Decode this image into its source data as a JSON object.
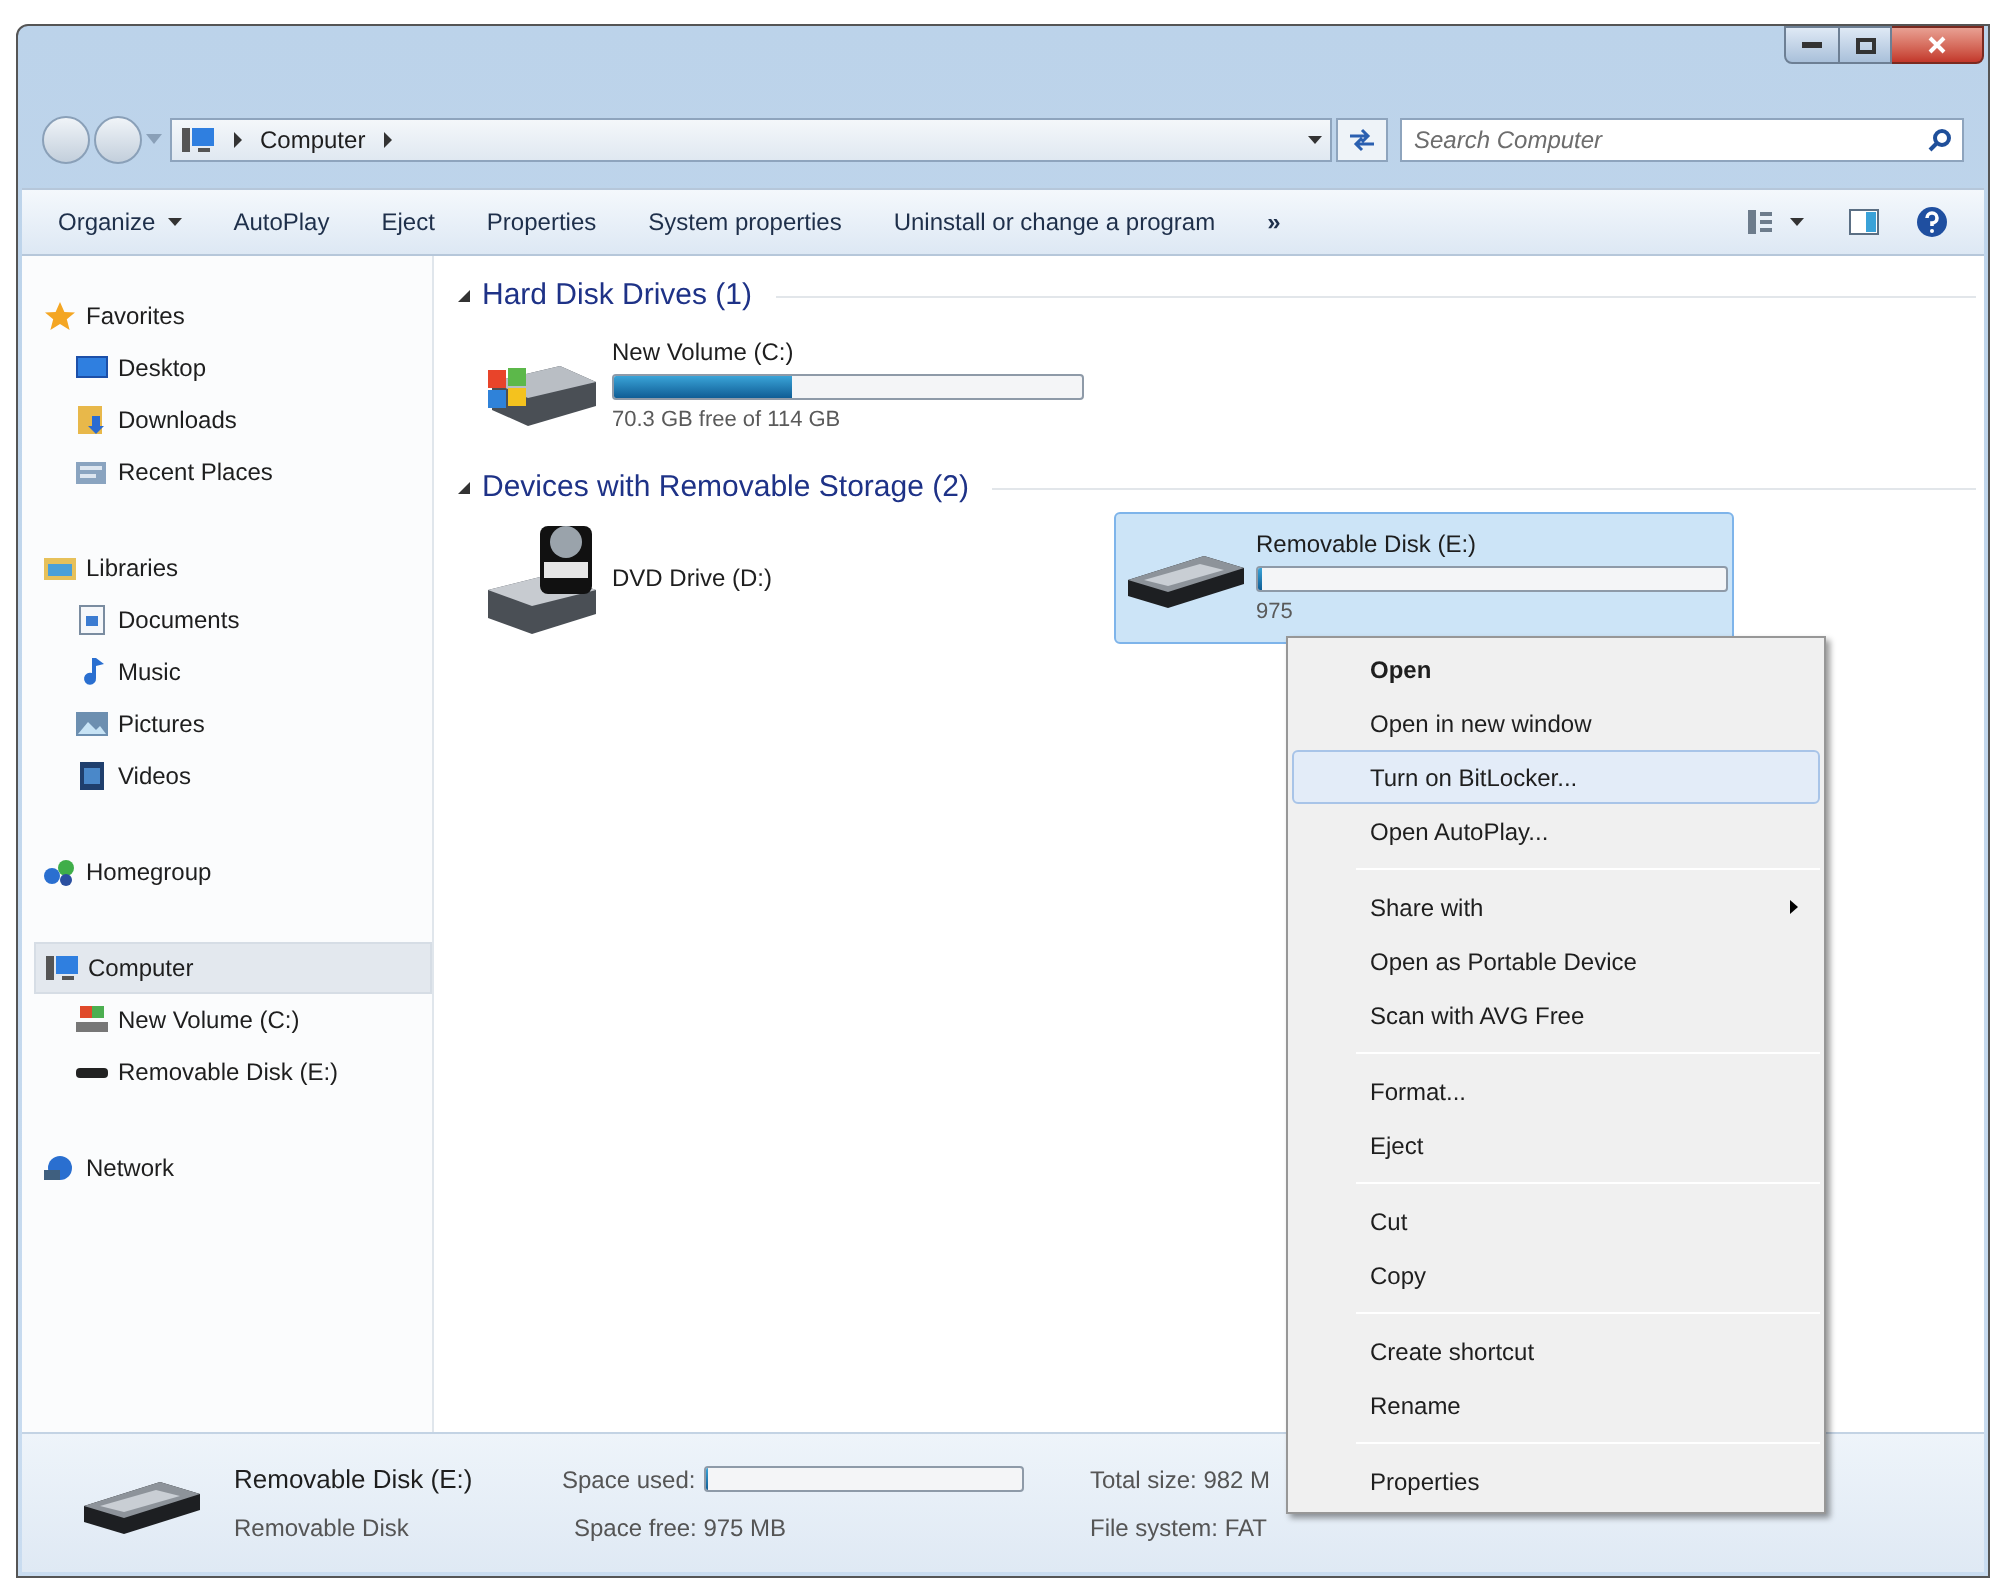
{
  "address_bar": {
    "crumbs": [
      "Computer"
    ]
  },
  "search": {
    "placeholder": "Search Computer"
  },
  "toolbar": {
    "items": [
      {
        "label": "Organize",
        "has_menu": true
      },
      {
        "label": "AutoPlay",
        "has_menu": false
      },
      {
        "label": "Eject",
        "has_menu": false
      },
      {
        "label": "Properties",
        "has_menu": false
      },
      {
        "label": "System properties",
        "has_menu": false
      },
      {
        "label": "Uninstall or change a program",
        "has_menu": false
      }
    ],
    "overflow": "»"
  },
  "sidebar": {
    "groups": [
      {
        "label": "Favorites",
        "selected": false,
        "children": [
          {
            "label": "Desktop",
            "selected": false
          },
          {
            "label": "Downloads",
            "selected": false
          },
          {
            "label": "Recent Places",
            "selected": false
          }
        ]
      },
      {
        "label": "Libraries",
        "selected": false,
        "children": [
          {
            "label": "Documents",
            "selected": false
          },
          {
            "label": "Music",
            "selected": false
          },
          {
            "label": "Pictures",
            "selected": false
          },
          {
            "label": "Videos",
            "selected": false
          }
        ]
      },
      {
        "label": "Homegroup",
        "selected": false
      },
      {
        "label": "Computer",
        "selected": true,
        "children": [
          {
            "label": "New Volume (C:)",
            "selected": false
          },
          {
            "label": "Removable Disk (E:)",
            "selected": false
          }
        ]
      },
      {
        "label": "Network",
        "selected": false
      }
    ]
  },
  "content": {
    "groups": [
      {
        "title": "Hard Disk Drives (1)",
        "expanded": true,
        "drives": [
          {
            "kind": "hdd",
            "name": "New Volume (C:)",
            "level": 0.38,
            "free": "70.3 GB free of 114 GB",
            "selected": false
          }
        ]
      },
      {
        "title": "Devices with Removable Storage (2)",
        "expanded": true,
        "drives": [
          {
            "kind": "optical",
            "name": "DVD Drive (D:)",
            "selected": false
          },
          {
            "kind": "removable",
            "name": "Removable Disk (E:)",
            "level": 0.01,
            "free": "975",
            "selected": true
          }
        ]
      }
    ]
  },
  "context_menu": {
    "sections": [
      [
        {
          "label": "Open",
          "default": true,
          "selected": false,
          "submenu": false
        },
        {
          "label": "Open in new window",
          "default": false,
          "selected": false,
          "submenu": false
        },
        {
          "label": "Turn on BitLocker...",
          "default": false,
          "selected": true,
          "submenu": false
        },
        {
          "label": "Open AutoPlay...",
          "default": false,
          "selected": false,
          "submenu": false
        }
      ],
      [
        {
          "label": "Share with",
          "default": false,
          "selected": false,
          "submenu": true
        },
        {
          "label": "Open as Portable Device",
          "default": false,
          "selected": false,
          "submenu": false
        },
        {
          "label": "Scan with AVG Free",
          "default": false,
          "selected": false,
          "submenu": false
        }
      ],
      [
        {
          "label": "Format...",
          "default": false,
          "selected": false,
          "submenu": false
        },
        {
          "label": "Eject",
          "default": false,
          "selected": false,
          "submenu": false
        }
      ],
      [
        {
          "label": "Cut",
          "default": false,
          "selected": false,
          "submenu": false
        },
        {
          "label": "Copy",
          "default": false,
          "selected": false,
          "submenu": false
        }
      ],
      [
        {
          "label": "Create shortcut",
          "default": false,
          "selected": false,
          "submenu": false
        },
        {
          "label": "Rename",
          "default": false,
          "selected": false,
          "submenu": false
        }
      ],
      [
        {
          "label": "Properties",
          "default": false,
          "selected": false,
          "submenu": false
        }
      ]
    ]
  },
  "details": {
    "name": "Removable Disk (E:)",
    "type": "Removable Disk",
    "space_used": {
      "label": "Space used:",
      "level": 0.01
    },
    "space_free": "Space free: 975 MB",
    "total_size": "Total size: 982 M",
    "file_system": "File system: FAT"
  }
}
